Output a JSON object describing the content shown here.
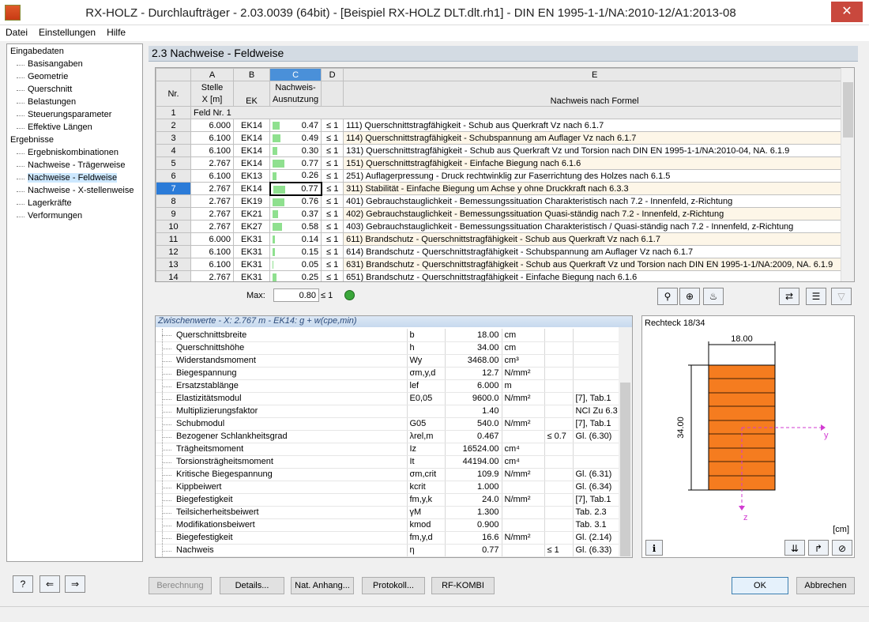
{
  "window": {
    "title": "RX-HOLZ - Durchlaufträger - 2.03.0039 (64bit) - [Beispiel RX-HOLZ DLT.dlt.rh1] - DIN EN 1995-1-1/NA:2010-12/A1:2013-08",
    "close": "✕"
  },
  "menu": [
    "Datei",
    "Einstellungen",
    "Hilfe"
  ],
  "nav": {
    "groups": [
      {
        "label": "Eingabedaten",
        "items": [
          "Basisangaben",
          "Geometrie",
          "Querschnitt",
          "Belastungen",
          "Steuerungsparameter",
          "Effektive Längen"
        ]
      },
      {
        "label": "Ergebnisse",
        "items": [
          "Ergebniskombinationen",
          "Nachweise - Trägerweise",
          "Nachweise - Feldweise",
          "Nachweise - X-stellenweise",
          "Lagerkräfte",
          "Verformungen"
        ]
      }
    ],
    "selected": "Nachweise - Feldweise"
  },
  "header": "2.3 Nachweise - Feldweise",
  "grid": {
    "col_letters": [
      "A",
      "B",
      "C",
      "D",
      "E"
    ],
    "col_nr": "Nr.",
    "col_a1": "Stelle",
    "col_a2": "X [m]",
    "col_b": "EK",
    "col_c1": "Nachweis-",
    "col_c2": "Ausnutzung",
    "col_e": "Nachweis nach Formel",
    "group_row": {
      "nr": "1",
      "label": "Feld Nr. 1"
    },
    "rows": [
      {
        "nr": "2",
        "x": "6.000",
        "ek": "EK14",
        "u": "0.47",
        "le": "≤ 1",
        "f": "111) Querschnittstragfähigkeit - Schub aus Querkraft Vz nach 6.1.7",
        "val": 0.47
      },
      {
        "nr": "3",
        "x": "6.100",
        "ek": "EK14",
        "u": "0.49",
        "le": "≤ 1",
        "f": "114) Querschnittstragfähigkeit - Schubspannung am Auflager Vz nach 6.1.7",
        "val": 0.49
      },
      {
        "nr": "4",
        "x": "6.100",
        "ek": "EK14",
        "u": "0.30",
        "le": "≤ 1",
        "f": "131) Querschnittstragfähigkeit - Schub aus Querkraft Vz und Torsion nach DIN EN 1995-1-1/NA:2010-04, NA. 6.1.9",
        "val": 0.3
      },
      {
        "nr": "5",
        "x": "2.767",
        "ek": "EK14",
        "u": "0.77",
        "le": "≤ 1",
        "f": "151) Querschnittstragfähigkeit - Einfache Biegung nach 6.1.6",
        "val": 0.77
      },
      {
        "nr": "6",
        "x": "6.100",
        "ek": "EK13",
        "u": "0.26",
        "le": "≤ 1",
        "f": "251) Auflagerpressung - Druck rechtwinklig zur Faserrichtung des Holzes nach 6.1.5",
        "val": 0.26
      },
      {
        "nr": "7",
        "x": "2.767",
        "ek": "EK14",
        "u": "0.77",
        "le": "≤ 1",
        "f": "311) Stabilität - Einfache Biegung um Achse y ohne Druckkraft nach 6.3.3",
        "val": 0.77
      },
      {
        "nr": "8",
        "x": "2.767",
        "ek": "EK19",
        "u": "0.76",
        "le": "≤ 1",
        "f": "401) Gebrauchstauglichkeit - Bemessungssituation Charakteristisch nach 7.2 - Innenfeld, z-Richtung",
        "val": 0.76
      },
      {
        "nr": "9",
        "x": "2.767",
        "ek": "EK21",
        "u": "0.37",
        "le": "≤ 1",
        "f": "402) Gebrauchstauglichkeit - Bemessungssituation Quasi-ständig nach 7.2 - Innenfeld, z-Richtung",
        "val": 0.37
      },
      {
        "nr": "10",
        "x": "2.767",
        "ek": "EK27",
        "u": "0.58",
        "le": "≤ 1",
        "f": "403) Gebrauchstauglichkeit - Bemessungssituation Charakteristisch / Quasi-ständig nach 7.2 - Innenfeld, z-Richtung",
        "val": 0.58
      },
      {
        "nr": "11",
        "x": "6.000",
        "ek": "EK31",
        "u": "0.14",
        "le": "≤ 1",
        "f": "611) Brandschutz - Querschnittstragfähigkeit - Schub aus Querkraft Vz nach 6.1.7",
        "val": 0.14
      },
      {
        "nr": "12",
        "x": "6.100",
        "ek": "EK31",
        "u": "0.15",
        "le": "≤ 1",
        "f": "614) Brandschutz - Querschnittstragfähigkeit - Schubspannung am Auflager Vz nach 6.1.7",
        "val": 0.15
      },
      {
        "nr": "13",
        "x": "6.100",
        "ek": "EK31",
        "u": "0.05",
        "le": "≤ 1",
        "f": "631) Brandschutz - Querschnittstragfähigkeit - Schub aus Querkraft Vz und Torsion nach DIN EN 1995-1-1/NA:2009, NA. 6.1.9",
        "val": 0.05
      },
      {
        "nr": "14",
        "x": "2.767",
        "ek": "EK31",
        "u": "0.25",
        "le": "≤ 1",
        "f": "651) Brandschutz - Querschnittstragfähigkeit - Einfache Biegung nach 6.1.6",
        "val": 0.25
      }
    ],
    "selected_nr": "7"
  },
  "max": {
    "label": "Max:",
    "value": "0.80",
    "le": "≤ 1"
  },
  "zw": {
    "head": "Zwischenwerte  - X: 2.767 m  -  EK14: g + w(cpe,min)",
    "rows": [
      {
        "n": "Querschnittsbreite",
        "s": "b",
        "v": "18.00",
        "u": "cm",
        "l": "",
        "r": ""
      },
      {
        "n": "Querschnittshöhe",
        "s": "h",
        "v": "34.00",
        "u": "cm",
        "l": "",
        "r": ""
      },
      {
        "n": "Widerstandsmoment",
        "s": "Wy",
        "v": "3468.00",
        "u": "cm³",
        "l": "",
        "r": ""
      },
      {
        "n": "Biegespannung",
        "s": "σm,y,d",
        "v": "12.7",
        "u": "N/mm²",
        "l": "",
        "r": ""
      },
      {
        "n": "Ersatzstablänge",
        "s": "lef",
        "v": "6.000",
        "u": "m",
        "l": "",
        "r": ""
      },
      {
        "n": "Elastizitätsmodul",
        "s": "E0,05",
        "v": "9600.0",
        "u": "N/mm²",
        "l": "",
        "r": "[7], Tab.1"
      },
      {
        "n": "Multiplizierungsfaktor",
        "s": "",
        "v": "1.40",
        "u": "",
        "l": "",
        "r": "NCI Zu 6.3"
      },
      {
        "n": "Schubmodul",
        "s": "G05",
        "v": "540.0",
        "u": "N/mm²",
        "l": "",
        "r": "[7], Tab.1"
      },
      {
        "n": "Bezogener Schlankheitsgrad",
        "s": "λrel,m",
        "v": "0.467",
        "u": "",
        "l": "≤ 0.7",
        "r": "Gl. (6.30)"
      },
      {
        "n": "Trägheitsmoment",
        "s": "Iz",
        "v": "16524.00",
        "u": "cm⁴",
        "l": "",
        "r": ""
      },
      {
        "n": "Torsionsträgheitsmoment",
        "s": "It",
        "v": "44194.00",
        "u": "cm⁴",
        "l": "",
        "r": ""
      },
      {
        "n": "Kritische Biegespannung",
        "s": "σm,crit",
        "v": "109.9",
        "u": "N/mm²",
        "l": "",
        "r": "Gl. (6.31)"
      },
      {
        "n": "Kippbeiwert",
        "s": "kcrit",
        "v": "1.000",
        "u": "",
        "l": "",
        "r": "Gl. (6.34)"
      },
      {
        "n": "Biegefestigkeit",
        "s": "fm,y,k",
        "v": "24.0",
        "u": "N/mm²",
        "l": "",
        "r": "[7], Tab.1"
      },
      {
        "n": "Teilsicherheitsbeiwert",
        "s": "γM",
        "v": "1.300",
        "u": "",
        "l": "",
        "r": "Tab. 2.3"
      },
      {
        "n": "Modifikationsbeiwert",
        "s": "kmod",
        "v": "0.900",
        "u": "",
        "l": "",
        "r": "Tab. 3.1"
      },
      {
        "n": "Biegefestigkeit",
        "s": "fm,y,d",
        "v": "16.6",
        "u": "N/mm²",
        "l": "",
        "r": "Gl. (2.14)"
      },
      {
        "n": "Nachweis",
        "s": "η",
        "v": "0.77",
        "u": "",
        "l": "≤ 1",
        "r": "Gl. (6.33)"
      }
    ]
  },
  "section": {
    "caption": "Rechteck 18/34",
    "width_label": "18.00",
    "height_label": "34.00",
    "axis_y": "y",
    "axis_z": "z",
    "unit": "[cm]"
  },
  "buttons": {
    "berechnung": "Berechnung",
    "details": "Details...",
    "nat": "Nat. Anhang...",
    "protokoll": "Protokoll...",
    "rfkombi": "RF-KOMBI",
    "ok": "OK",
    "abbrechen": "Abbrechen"
  },
  "colors": {
    "accent": "#2b7bd8",
    "bar": "#8fe08f",
    "section_fill": "#f57c1f",
    "axis": "#d23bd2"
  }
}
